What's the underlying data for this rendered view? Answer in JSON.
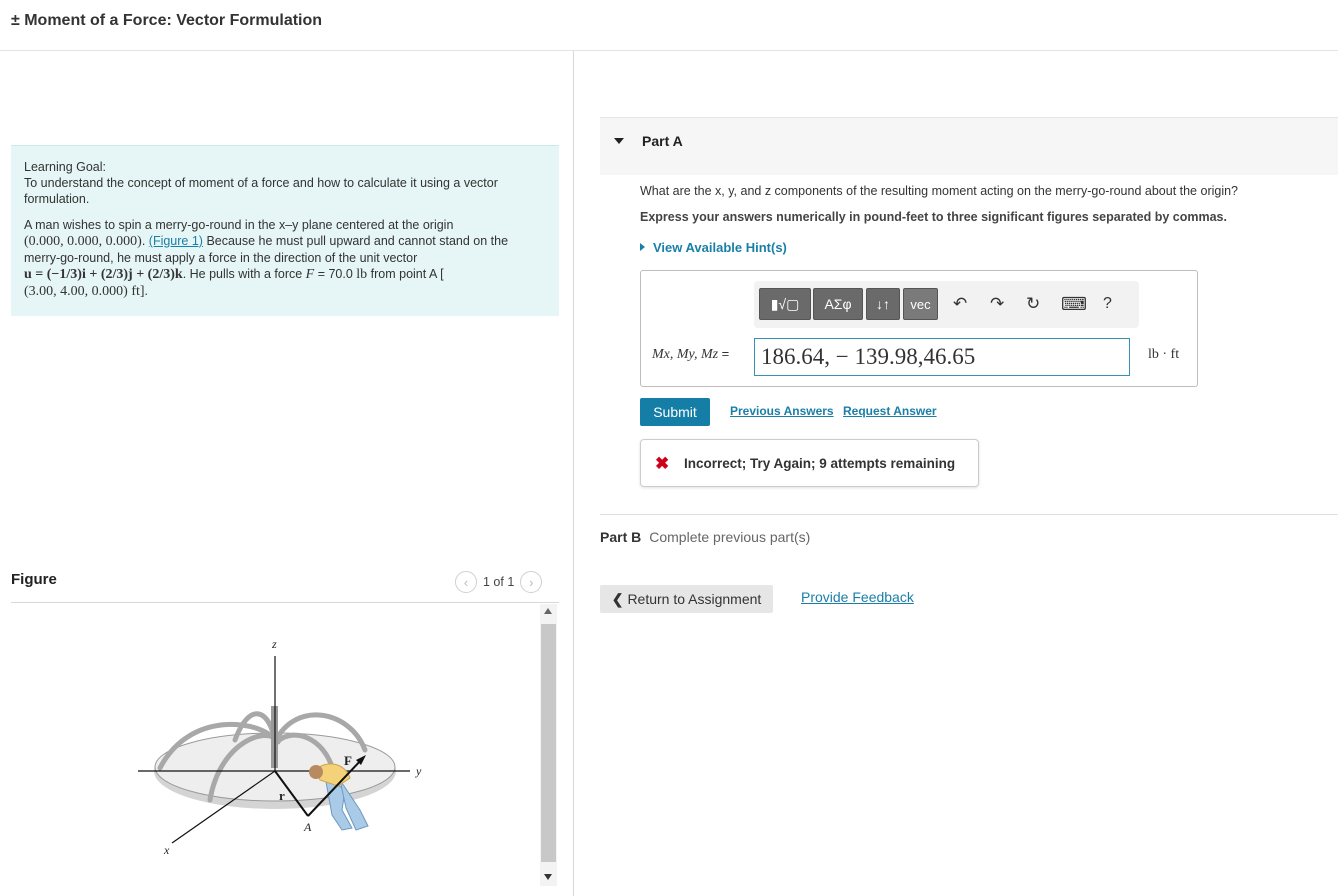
{
  "page": {
    "title": "± Moment of a Force: Vector Formulation"
  },
  "learning_goal": {
    "label": "Learning Goal:",
    "text": "To understand the concept of moment of a force and how to calculate it using a vector formulation.",
    "problem_1": "A man wishes to spin a merry-go-round in the x–y plane centered at the origin",
    "origin": "(0.000, 0.000, 0.000)",
    "figure_link": "(Figure 1)",
    "problem_2": " Because he must pull upward and cannot stand on the merry-go-round, he must apply a force in the direction of the unit vector",
    "unit_vector": "u = (−1/3)i + (2/3)j + (2/3)k",
    "problem_3": ". He pulls with a force ",
    "force_var": "F",
    "force_eq": " = 70.0 ",
    "force_unit": "lb",
    "problem_4": " from point A [",
    "point_a": "(3.00, 4.00, 0.000) ft]",
    "period": "."
  },
  "figure": {
    "label": "Figure",
    "pager_text": "1 of 1",
    "labels": {
      "z": "z",
      "y": "y",
      "x": "x",
      "r": "r",
      "F": "F",
      "A": "A"
    }
  },
  "part_a": {
    "label": "Part A",
    "question": "What are the x, y, and z components of the resulting moment acting on the merry-go-round about the origin?",
    "express": "Express your answers numerically in pound-feet to three significant figures separated by commas.",
    "hint": "View Available Hint(s)",
    "toolbar": {
      "btn_template": "▮√▢",
      "btn_greek": "ΑΣφ",
      "btn_arrows": "↓↑",
      "btn_vec": "vec",
      "undo": "↶",
      "redo": "↷",
      "reset": "↻",
      "keyboard": "⌨",
      "help": "?"
    },
    "answer_label": "Mx, My, Mz",
    "answer_label_eq": "=",
    "answer_value": "186.64, − 139.98,46.65",
    "unit": "lb · ft",
    "submit": "Submit",
    "previous_answers": "Previous Answers",
    "request_answer": "Request Answer",
    "feedback_icon": "✖",
    "feedback": "Incorrect; Try Again; 9 attempts remaining"
  },
  "part_b": {
    "label": "Part B",
    "status": "Complete previous part(s)"
  },
  "footer": {
    "return_chevron": "❮",
    "return": "Return to Assignment",
    "provide_feedback": "Provide Feedback"
  },
  "colors": {
    "accent": "#147ea6",
    "link": "#1a7fa8",
    "goal_bg": "#e6f5f5",
    "error": "#d0001b"
  }
}
